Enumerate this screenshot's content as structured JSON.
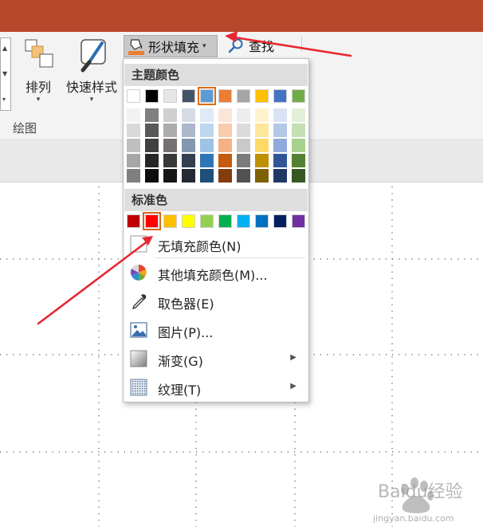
{
  "ribbon": {
    "arrange_label": "排列",
    "quick_styles_label": "快速样式",
    "group_label": "绘图",
    "shape_fill_label": "形状填充",
    "find_label": "查找"
  },
  "menu": {
    "theme_colors_title": "主题颜色",
    "standard_colors_title": "标准色",
    "no_fill": "无填充颜色(N)",
    "more_colors": "其他填充颜色(M)...",
    "eyedropper": "取色器(E)",
    "picture": "图片(P)...",
    "gradient": "渐变(G)",
    "texture": "纹理(T)"
  },
  "colors": {
    "theme_top": [
      "#ffffff",
      "#000000",
      "#e7e6e6",
      "#44546a",
      "#5b9bd5",
      "#ed7d31",
      "#a5a5a5",
      "#ffc000",
      "#4472c4",
      "#70ad47"
    ],
    "theme_shades": [
      [
        "#f2f2f2",
        "#d9d9d9",
        "#bfbfbf",
        "#a6a6a6",
        "#7f7f7f"
      ],
      [
        "#7f7f7f",
        "#595959",
        "#404040",
        "#262626",
        "#0d0d0d"
      ],
      [
        "#d0cece",
        "#aeabab",
        "#757171",
        "#3a3838",
        "#171616"
      ],
      [
        "#d6dce5",
        "#adb9ca",
        "#8497b0",
        "#333f50",
        "#222a35"
      ],
      [
        "#deebf7",
        "#bdd7ee",
        "#9dc3e6",
        "#2e75b6",
        "#1f4e79"
      ],
      [
        "#fbe5d6",
        "#f8cbad",
        "#f4b183",
        "#c55a11",
        "#843c0c"
      ],
      [
        "#ededed",
        "#dbdbdb",
        "#c9c9c9",
        "#7b7b7b",
        "#525252"
      ],
      [
        "#fff2cc",
        "#ffe699",
        "#ffd966",
        "#bf9000",
        "#7f6000"
      ],
      [
        "#dae3f3",
        "#b4c7e7",
        "#8faadc",
        "#2f5597",
        "#203864"
      ],
      [
        "#e2f0d9",
        "#c5e0b4",
        "#a9d18e",
        "#548235",
        "#385723"
      ]
    ],
    "standard": [
      "#c00000",
      "#ff0000",
      "#ffc000",
      "#ffff00",
      "#92d050",
      "#00b050",
      "#00b0f0",
      "#0070c0",
      "#002060",
      "#7030a0"
    ],
    "title_bar": "#b7472a",
    "annotation_arrow": "#e8272f"
  },
  "watermark": {
    "brand": "Baidu经验",
    "url": "jingyan.baidu.com"
  }
}
